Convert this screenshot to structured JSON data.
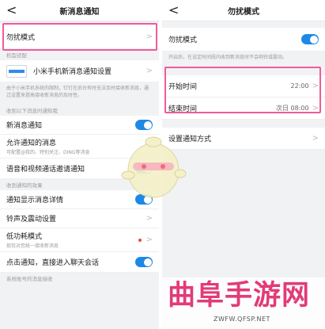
{
  "left": {
    "title": "新消息通知",
    "back": "<",
    "dnd_label": "勿扰模式",
    "section_model": "机型适配",
    "xiaomi_label": "小米手机新消息通知设置",
    "xiaomi_hint": "由于小米手机系统的限制，钉钉在后台有时无法及时接收新消息，通过设置来提高接收新消息的及时性。",
    "section_receive": "收到以下消息时通知我",
    "new_msg_label": "新消息通知",
    "allow_label": "允许通知的消息",
    "allow_sub": "可配置@我的、特别关注、DING等消息",
    "voice_label": "语音和视频通话邀请通知",
    "section_effect": "收到通知的效果",
    "detail_label": "通知显示消息详情",
    "ring_label": "铃声及震动设置",
    "low_label": "低功耗模式",
    "low_sub": "现仅对您统一接收新消息",
    "click_label": "点击通知，直接进入聊天会话",
    "section_system": "系统账号的消息接收"
  },
  "right": {
    "title": "勿扰模式",
    "back": "<",
    "dnd_label": "勿扰模式",
    "dnd_hint": "开启后，在设定时间段内收到新消息时不会响铃或震动。",
    "start_label": "开始时间",
    "start_value": "22:00",
    "end_label": "结束时间",
    "end_value": "次日 08:00",
    "method_label": "设置通知方式"
  },
  "chevron": ">",
  "watermark": {
    "cn": "曲阜手游网",
    "url": "ZWFW.QFSP.NET"
  },
  "colors": {
    "accent": "#1e88e5",
    "highlight": "#f25a9b",
    "watermark": "#e23b77"
  }
}
